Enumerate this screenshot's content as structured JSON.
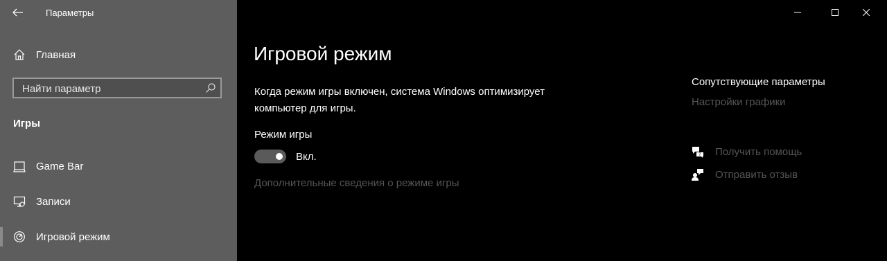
{
  "window": {
    "title": "Параметры",
    "controls": {
      "minimize": "minimize-icon",
      "maximize": "maximize-icon",
      "close": "close-icon"
    }
  },
  "sidebar": {
    "home_label": "Главная",
    "search_placeholder": "Найти параметр",
    "section": "Игры",
    "items": [
      {
        "label": "Game Bar",
        "icon": "game-bar-icon"
      },
      {
        "label": "Записи",
        "icon": "captures-icon"
      },
      {
        "label": "Игровой режим",
        "icon": "game-mode-icon",
        "selected": true
      }
    ]
  },
  "main": {
    "title": "Игровой режим",
    "description": "Когда режим игры включен, система Windows оптимизирует компьютер для игры.",
    "setting_label": "Режим игры",
    "toggle_on": true,
    "toggle_state": "Вкл.",
    "more_info_link": "Дополнительные сведения о режиме игры"
  },
  "related": {
    "heading": "Сопутствующие параметры",
    "graphics_link": "Настройки графики",
    "help_label": "Получить помощь",
    "feedback_label": "Отправить отзыв"
  },
  "colors": {
    "sidebar_bg": "#5d5d5d",
    "main_bg": "#000000",
    "link_dim": "#555555"
  }
}
